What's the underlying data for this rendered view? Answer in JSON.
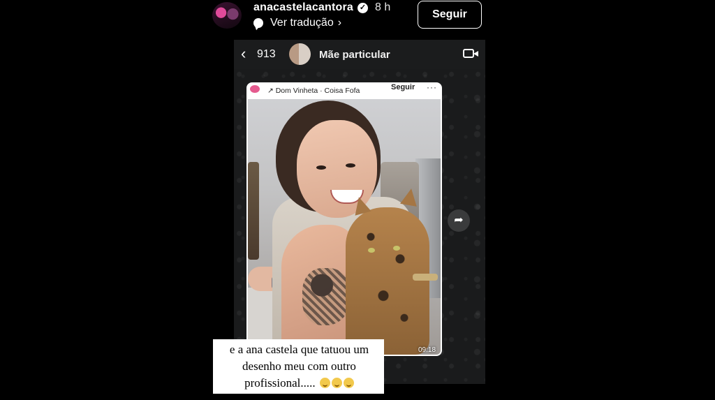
{
  "story": {
    "username": "anacastelacantora",
    "verified_icon": "check-badge-icon",
    "time": "8 h",
    "translate_label": "Ver tradução",
    "translate_chevron": "›",
    "follow_label": "Seguir"
  },
  "chat": {
    "back_icon": "‹",
    "unread_count": "913",
    "contact_name": "Mãe particular",
    "video_icon": "video-camera-icon"
  },
  "shared_post": {
    "song": "↗ Dom Vinheta · Coisa Fofa",
    "follow_label": "Seguir",
    "more_label": "···",
    "timestamp": "09:18",
    "forward_icon": "➦"
  },
  "caption": {
    "lines": [
      "e a ana castela que tatuou um",
      "desenho meu com outro",
      "profissional....."
    ],
    "emoji_icon": "grinning-face-icon",
    "emoji_count": 3
  }
}
